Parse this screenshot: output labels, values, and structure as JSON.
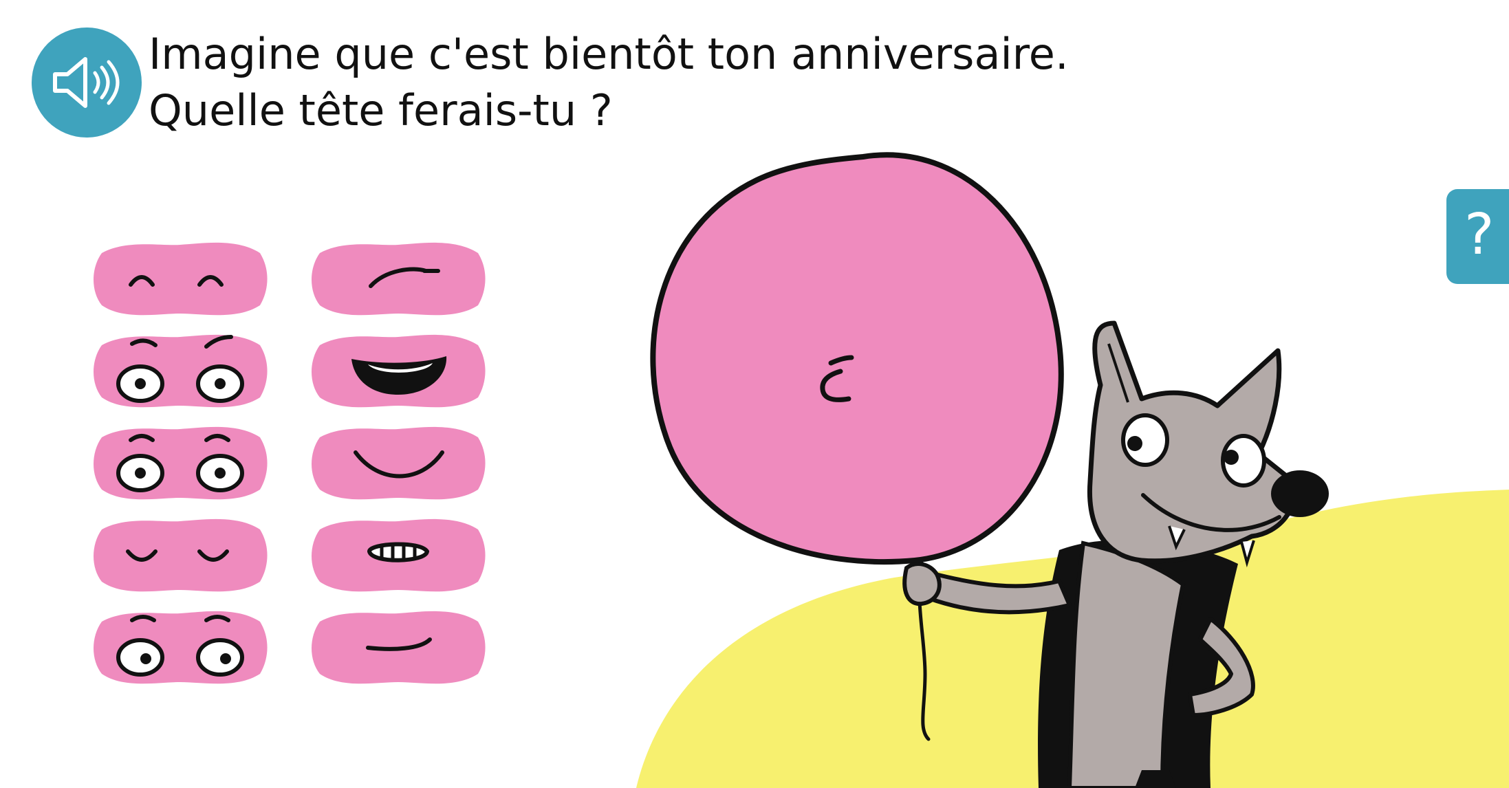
{
  "instruction": {
    "line1": "Imagine que c'est bientôt ton anniversaire.",
    "line2": "Quelle tête ferais-tu ?"
  },
  "help_button": {
    "label": "?"
  },
  "icons": {
    "audio": "speaker-icon"
  },
  "parts": {
    "eyes": [
      "eyes-closed-happy",
      "eyes-open-surprised",
      "eyes-open-wide",
      "eyes-closed-smile",
      "eyes-looking-side"
    ],
    "mouths": [
      "mouth-slight-frown",
      "mouth-open-laugh",
      "mouth-smile",
      "mouth-teeth-grimace",
      "mouth-neutral-smirk"
    ]
  },
  "colors": {
    "accent": "#3fa3bd",
    "part_pink": "#ef8bbe",
    "balloon_pink": "#ef8bbe",
    "ground_yellow": "#f7f06f",
    "wolf_grey": "#b3aaa8"
  }
}
